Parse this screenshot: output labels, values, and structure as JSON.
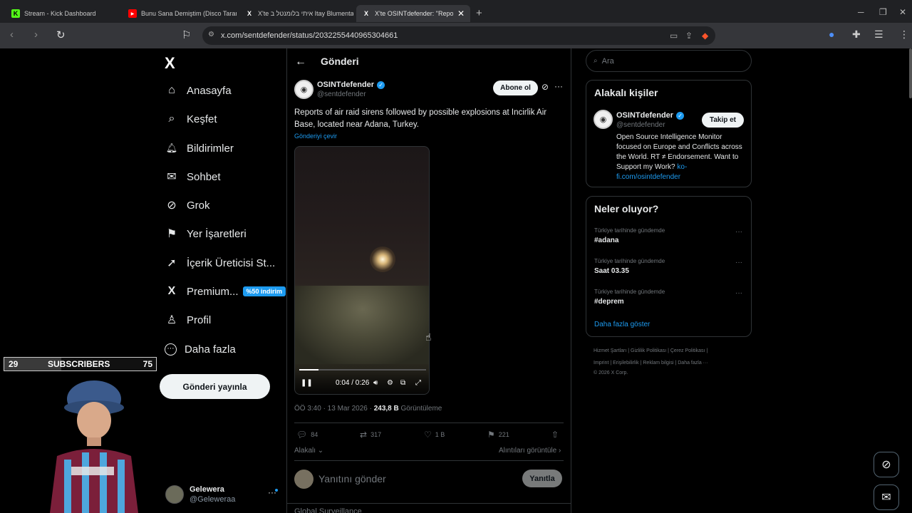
{
  "browser": {
    "tabs": [
      {
        "title": "Stream - Kick Dashboard",
        "favicon": "K"
      },
      {
        "title": "Bunu Sana Demiştim (Disco Tarantula...",
        "favicon": "▶"
      },
      {
        "title": "X'te איתי בלומנטל ב Itay Blumental:",
        "favicon": "X"
      },
      {
        "title": "X'te OSINTdefender: \"Repo...",
        "favicon": "X"
      }
    ],
    "url": "x.com/sentdefender/status/2032255440965304661"
  },
  "sidebar": {
    "logo": "X",
    "items": [
      {
        "label": "Anasayfa",
        "icon": "⌂"
      },
      {
        "label": "Keşfet",
        "icon": "⌕"
      },
      {
        "label": "Bildirimler",
        "icon": "🔔︎"
      },
      {
        "label": "Sohbet",
        "icon": "✉"
      },
      {
        "label": "Grok",
        "icon": "⊘"
      },
      {
        "label": "Yer İşaretleri",
        "icon": "⚑"
      },
      {
        "label": "İçerik Üreticisi St...",
        "icon": "➚"
      },
      {
        "label": "Premium...",
        "icon": "X"
      },
      {
        "label": "Profil",
        "icon": "♙"
      },
      {
        "label": "Daha fazla",
        "icon": "⋯"
      }
    ],
    "premium_badge": "%50 indirim",
    "post_button": "Gönderi yayınla",
    "account": {
      "name": "Gelewera",
      "handle": "@Geleweraa"
    }
  },
  "overlay": {
    "left_count": "29",
    "label": "SUBSCRIBERS",
    "right_count": "75"
  },
  "post": {
    "header_title": "Gönderi",
    "author_name": "OSINTdefender",
    "author_handle": "@sentdefender",
    "subscribe_label": "Abone ol",
    "text": "Reports of air raid sirens followed by possible explosions at Incirlik Air Base, located near Adana, Turkey.",
    "translate_label": "Gönderiyi çevir",
    "video_time": "0:04 / 0:26",
    "video_progress_fraction": 0.15,
    "timestamp": "ÖÖ 3:40 · 13 Mar 2026 · ",
    "views_count": "243,8 B",
    "views_label": " Görüntüleme",
    "replies": "84",
    "reposts": "317",
    "likes": "1 B",
    "bookmarks": "221",
    "relevance_label": "Alakalı",
    "quotes_label": "Alıntıları görüntüle",
    "reply_placeholder": "Yanıtını gönder",
    "reply_button": "Yanıtla",
    "next_post_author": "Global Surveillance"
  },
  "right": {
    "search_placeholder": "Ara",
    "related_title": "Alakalı kişiler",
    "related_name": "OSINTdefender",
    "related_handle": "@sentdefender",
    "follow_label": "Takip et",
    "related_bio": "Open Source Intelligence Monitor focused on Europe and Conflicts across the World. RT ≠ Endorsement. Want to Support my Work? ",
    "related_link": "ko-fi.com/osintdefender",
    "trends_title": "Neler oluyor?",
    "trends": [
      {
        "category": "Türkiye tarihinde gündemde",
        "tag": "#adana"
      },
      {
        "category": "Türkiye tarihinde gündemde",
        "tag": "Saat 03.35"
      },
      {
        "category": "Türkiye tarihinde gündemde",
        "tag": "#deprem"
      }
    ],
    "show_more": "Daha fazla göster",
    "footer_line1": "Hizmet Şartları  |  Gizlilik Politikası  |  Çerez Politikası  |",
    "footer_line2": "Imprint  |  Erişilebilirlik  |  Reklam bilgisi  |  Daha fazla ···",
    "footer_line3": "© 2026 X Corp."
  },
  "colors": {
    "accent": "#1d9bf0",
    "background": "#000000"
  }
}
